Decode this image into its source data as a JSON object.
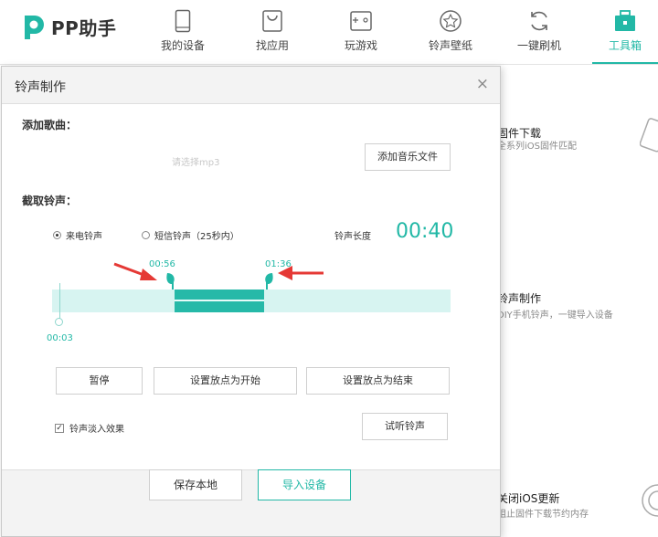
{
  "app": {
    "logo_text": "PP助手"
  },
  "nav": [
    {
      "label": "我的设备",
      "icon": "phone-icon"
    },
    {
      "label": "找应用",
      "icon": "bag-icon"
    },
    {
      "label": "玩游戏",
      "icon": "gamepad-icon"
    },
    {
      "label": "铃声壁纸",
      "icon": "star-icon"
    },
    {
      "label": "一键刷机",
      "icon": "refresh-icon"
    },
    {
      "label": "工具箱",
      "icon": "toolbox-icon",
      "active": true
    }
  ],
  "background_cards": [
    {
      "title": "固件下载",
      "desc": "全系列iOS固件匹配"
    },
    {
      "title": "铃声制作",
      "desc": "DIY手机铃声，一键导入设备"
    },
    {
      "title": "关闭iOS更新",
      "desc": "阻止固件下载节约内存"
    }
  ],
  "dialog": {
    "title": "铃声制作",
    "close_symbol": "×",
    "add_song_label": "添加歌曲：",
    "file_placeholder": "请选择mp3",
    "add_music_button": "添加音乐文件",
    "cut_label": "截取铃声：",
    "radio_call": "来电铃声",
    "radio_sms": "短信铃声（25秒内）",
    "radio_selected": "来电铃声",
    "length_label": "铃声长度",
    "length_value": "00:40",
    "start_marker": "00:56",
    "end_marker": "01:36",
    "playhead_time": "00:03",
    "pause_button": "暂停",
    "set_start_button": "设置放点为开始",
    "set_end_button": "设置放点为结束",
    "fade_checkbox": "铃声淡入效果",
    "fade_checked": true,
    "preview_button": "试听铃声",
    "save_local_button": "保存本地",
    "import_device_button": "导入设备"
  },
  "colors": {
    "accent": "#22b8a6",
    "track_bg": "#d7f4f1",
    "track_selected": "#26b9a8",
    "annotation_arrow": "#e53935"
  }
}
